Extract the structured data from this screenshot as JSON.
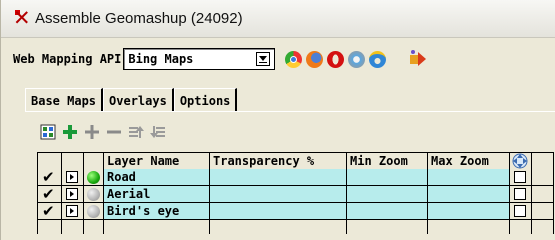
{
  "window": {
    "title": "Assemble Geomashup (24092)"
  },
  "api": {
    "label": "Web Mapping API",
    "selected": "Bing Maps",
    "browser_icons": [
      "chrome-icon",
      "firefox-icon",
      "opera-icon",
      "safari-icon",
      "internet-explorer-icon"
    ],
    "plugin_icon": "plugin-arrow-icon"
  },
  "tabs": [
    {
      "label": "Base Maps",
      "active": true
    },
    {
      "label": "Overlays",
      "active": false
    },
    {
      "label": "Options",
      "active": false
    }
  ],
  "toolbar": {
    "icons": [
      "grid-icon",
      "add-green-icon",
      "add-gray-icon",
      "remove-gray-icon",
      "move-up-icon",
      "move-down-icon"
    ]
  },
  "table": {
    "columns": [
      "",
      "",
      "",
      "Layer Name",
      "Transparency %",
      "Min Zoom",
      "Max Zoom",
      "",
      ""
    ],
    "rows": [
      {
        "name": "Road",
        "status": "active",
        "checked": true
      },
      {
        "name": "Aerial",
        "status": "inactive",
        "checked": true
      },
      {
        "name": "Bird's eye",
        "status": "inactive",
        "checked": true
      }
    ]
  },
  "colors": {
    "row_bg": "#b7ecec",
    "window_bg": "#ece9d8",
    "title_icon": "#b30000"
  }
}
